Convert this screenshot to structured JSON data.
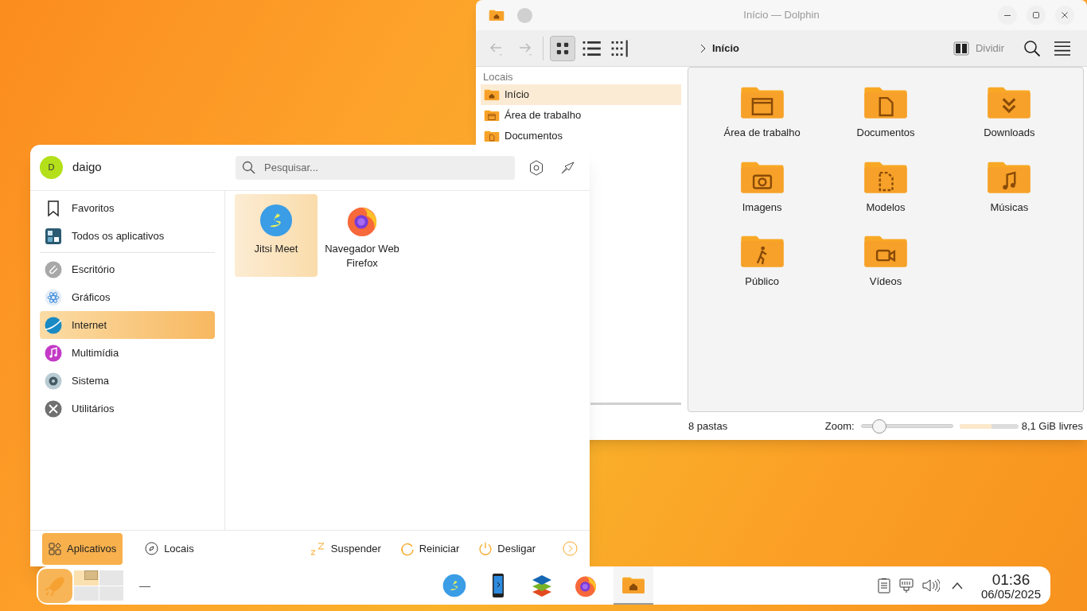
{
  "dolphin": {
    "title": "Início — Dolphin",
    "view_modes": [
      {
        "kind": "icons",
        "selected": true
      },
      {
        "kind": "details",
        "selected": false
      },
      {
        "kind": "compact",
        "selected": false
      }
    ],
    "breadcrumb": "Início",
    "split_label": "Dividir",
    "sidebar": {
      "heading": "Locais",
      "items": [
        {
          "label": "Início",
          "kind": "home",
          "selected": true
        },
        {
          "label": "Área de trabalho",
          "kind": "desktop",
          "selected": false
        },
        {
          "label": "Documentos",
          "kind": "document",
          "selected": false
        }
      ]
    },
    "folders": [
      {
        "label": "Área de trabalho",
        "kind": "desktop"
      },
      {
        "label": "Documentos",
        "kind": "document"
      },
      {
        "label": "Downloads",
        "kind": "download"
      },
      {
        "label": "Imagens",
        "kind": "camera"
      },
      {
        "label": "Modelos",
        "kind": "template"
      },
      {
        "label": "Músicas",
        "kind": "music"
      },
      {
        "label": "Público",
        "kind": "public"
      },
      {
        "label": "Vídeos",
        "kind": "video"
      }
    ],
    "status": "8 pastas",
    "zoom_label": "Zoom:",
    "zoom": {
      "level": 0.2
    },
    "free_space": {
      "level": 0.55,
      "label": "8,1 GiB livres"
    }
  },
  "launcher": {
    "user": {
      "initial": "D",
      "name": "daigo"
    },
    "search": {
      "placeholder": "Pesquisar..."
    },
    "top_items": [
      {
        "label": "Favoritos",
        "kind": "bookmark",
        "selected": false
      },
      {
        "label": "Todos os aplicativos",
        "kind": "grid",
        "selected": false
      }
    ],
    "categories": [
      {
        "label": "Escritório",
        "kind": "office",
        "selected": false
      },
      {
        "label": "Gráficos",
        "kind": "graphics",
        "selected": false
      },
      {
        "label": "Internet",
        "kind": "internet",
        "selected": true
      },
      {
        "label": "Multimídia",
        "kind": "multimedia",
        "selected": false
      },
      {
        "label": "Sistema",
        "kind": "system",
        "selected": false
      },
      {
        "label": "Utilitários",
        "kind": "utilities",
        "selected": false
      }
    ],
    "apps": [
      {
        "label": "Jitsi Meet",
        "kind": "jitsi",
        "selected": true
      },
      {
        "label": "Navegador Web Firefox",
        "kind": "firefox",
        "selected": false
      }
    ],
    "tabs": [
      {
        "label": "Aplicativos",
        "kind": "apps",
        "selected": true
      },
      {
        "label": "Locais",
        "kind": "places",
        "selected": false
      }
    ],
    "actions": [
      {
        "label": "Suspender",
        "kind": "sleep"
      },
      {
        "label": "Reiniciar",
        "kind": "restart"
      },
      {
        "label": "Desligar",
        "kind": "shutdown"
      }
    ]
  },
  "taskbar": {
    "desktops": [
      {
        "selected": true
      },
      {
        "selected": false
      },
      {
        "selected": false
      },
      {
        "selected": false
      }
    ],
    "separator": "—",
    "tasks": [
      {
        "kind": "jitsi",
        "active": false
      },
      {
        "kind": "phone",
        "active": false
      },
      {
        "kind": "layers",
        "active": false
      },
      {
        "kind": "firefox",
        "active": false
      },
      {
        "kind": "folder",
        "active": true
      }
    ],
    "time": "01:36",
    "date": "06/05/2025"
  }
}
